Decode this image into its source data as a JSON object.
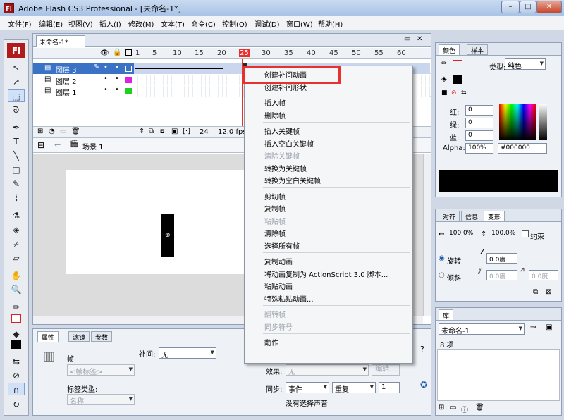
{
  "window": {
    "title": "Adobe Flash CS3 Professional - [未命名-1*]",
    "app_icon": "Fl",
    "controls": [
      "–",
      "□",
      "✕"
    ]
  },
  "menubar": [
    "文件(F)",
    "编辑(E)",
    "视图(V)",
    "插入(I)",
    "修改(M)",
    "文本(T)",
    "命令(C)",
    "控制(O)",
    "调试(D)",
    "窗口(W)",
    "帮助(H)"
  ],
  "toolbox": {
    "logo": "Fl"
  },
  "document": {
    "tab": "未命名-1*",
    "ruler": [
      "1",
      "5",
      "10",
      "15",
      "20",
      "25",
      "30",
      "35",
      "40",
      "45",
      "50",
      "55",
      "60"
    ],
    "layers": [
      {
        "name": "图层 3",
        "active": true,
        "color": "#3a73c6"
      },
      {
        "name": "图层 2",
        "active": false,
        "color": "#e020e0"
      },
      {
        "name": "图层 1",
        "active": false,
        "color": "#20d020"
      }
    ],
    "status": {
      "frame": "24",
      "fps": "12.0 fps"
    },
    "scene": "场景 1"
  },
  "context_menu": {
    "items": [
      {
        "label": "创建补间动画",
        "enabled": true
      },
      {
        "label": "创建补间形状",
        "enabled": true
      },
      {
        "sep": true
      },
      {
        "label": "插入帧",
        "enabled": true
      },
      {
        "label": "删除帧",
        "enabled": true
      },
      {
        "sep": true
      },
      {
        "label": "插入关键帧",
        "enabled": true
      },
      {
        "label": "插入空白关键帧",
        "enabled": true
      },
      {
        "label": "清除关键帧",
        "enabled": false
      },
      {
        "label": "转换为关键帧",
        "enabled": true
      },
      {
        "label": "转换为空白关键帧",
        "enabled": true
      },
      {
        "sep": true
      },
      {
        "label": "剪切帧",
        "enabled": true
      },
      {
        "label": "复制帧",
        "enabled": true
      },
      {
        "label": "粘贴帧",
        "enabled": false
      },
      {
        "label": "清除帧",
        "enabled": true
      },
      {
        "label": "选择所有帧",
        "enabled": true
      },
      {
        "sep": true
      },
      {
        "label": "复制动画",
        "enabled": true
      },
      {
        "label": "将动画复制为 ActionScript 3.0 脚本...",
        "enabled": true
      },
      {
        "label": "粘贴动画",
        "enabled": true
      },
      {
        "label": "特殊粘贴动画...",
        "enabled": true
      },
      {
        "sep": true
      },
      {
        "label": "翻转帧",
        "enabled": false
      },
      {
        "label": "同步符号",
        "enabled": false
      },
      {
        "sep": true
      },
      {
        "label": "動作",
        "enabled": true
      }
    ]
  },
  "properties": {
    "tabs": [
      "属性",
      "滤镜",
      "参数"
    ],
    "frame_label": "帧",
    "frame_name_placeholder": "<帧标签>",
    "tween_label": "补间:",
    "tween_value": "无",
    "label_type_label": "标签类型:",
    "label_type_value": "名称",
    "effect_label": "效果:",
    "effect_value": "无",
    "edit_button": "编辑...",
    "sync_label": "同步:",
    "sync_value": "事件",
    "repeat_value": "重复",
    "repeat_count": "1",
    "no_sound": "没有选择声音"
  },
  "color_panel": {
    "tabs": [
      "颜色",
      "样本"
    ],
    "type_label": "类型:",
    "type_value": "纯色",
    "red_label": "红:",
    "red": "0",
    "green_label": "绿:",
    "green": "0",
    "blue_label": "蓝:",
    "blue": "0",
    "alpha_label": "Alpha:",
    "alpha": "100%",
    "hex": "#000000"
  },
  "transform_panel": {
    "tabs": [
      "对齐",
      "信息",
      "变形"
    ],
    "scale_w": "100.0%",
    "scale_h": "100.0%",
    "constrain": "约束",
    "rotate": "旋转",
    "rotate_value": "0.0度",
    "skew": "倾斜",
    "skew_h": "0.0度",
    "skew_v": "0.0度"
  },
  "library_panel": {
    "tab": "库",
    "doc": "未命名-1",
    "count": "8 项"
  }
}
